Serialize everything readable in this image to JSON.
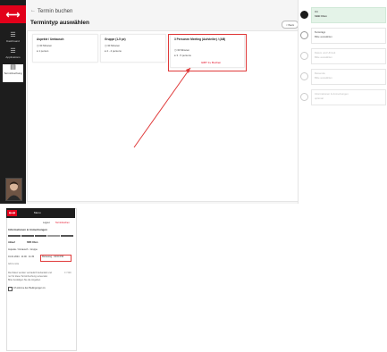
{
  "desktop": {
    "logo_glyph": "⟷",
    "back_arrow": "←",
    "app_title": "Termin buchen",
    "page_title": "Termintyp auswählen",
    "back_button": "< Back",
    "sidebar": [
      {
        "icon": "☰",
        "label": "Dashboard"
      },
      {
        "icon": "☰",
        "label": "Applications"
      },
      {
        "icon": "▤",
        "label": "Terminbuchung"
      }
    ],
    "cards": [
      {
        "title": "Aspekte / Umtausch",
        "line1": "30 Minuten",
        "line2": "1 person"
      },
      {
        "title": "Gruppe (1-5 pe)",
        "line1": "30 Minuten",
        "line2": "2 - 4 persons"
      },
      {
        "title": "3 Personen Meeting (Aufsteiler) / (AB)",
        "line1": "30 Minuten",
        "line2": "3 - 5 persons",
        "link": "GIBT 3+ Buchen"
      }
    ],
    "steps": [
      {
        "title": "Ort",
        "subtitle": "SBB Olten"
      },
      {
        "title": "Termintyp",
        "subtitle": "Bitte auswählen"
      },
      {
        "title": "Datum und Uhrzeit",
        "subtitle": "Bitte auswählen"
      },
      {
        "title": "Reisende",
        "subtitle": "Bitte auswählen"
      },
      {
        "title": "Informationen & Anmerkungen",
        "subtitle": "optional"
      }
    ]
  },
  "mobile": {
    "logo_glyph": "⟷",
    "header_title": "Menu",
    "top_link_1": "Logout",
    "top_link_2": "Terminbuchen",
    "section_title": "Informationen & Anmerkungen",
    "label_a": "Ablauf",
    "label_b": "SBB Olten",
    "line_1": "Aspekte / Umtausch · Gruppe",
    "fields": "01.01.2024 · 11:00 · 11:30",
    "highlight": "Reiseweg · 04:00 PM",
    "note": "Add a note",
    "para_1": "Die Daten werden vertraulich behandelt und",
    "para_2": "nur für diese Terminbuchung verwendet.",
    "para_3": "Bitte bestätigen Sie die Angaben.",
    "side_note": "0 / 500",
    "checkbox_label": "Ich stimme den Bedingungen zu"
  }
}
